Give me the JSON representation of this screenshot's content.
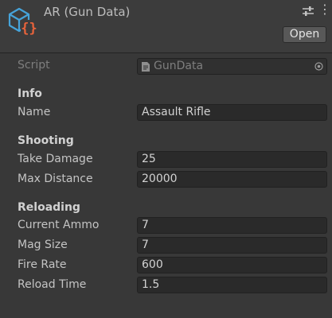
{
  "header": {
    "title": "AR (Gun Data)",
    "icon": "scriptable-object-icon",
    "open_label": "Open"
  },
  "script": {
    "label": "Script",
    "value": "GunData"
  },
  "sections": {
    "info": {
      "heading": "Info",
      "name_label": "Name",
      "name_value": "Assault Rifle"
    },
    "shooting": {
      "heading": "Shooting",
      "take_damage_label": "Take Damage",
      "take_damage_value": "25",
      "max_distance_label": "Max Distance",
      "max_distance_value": "20000"
    },
    "reloading": {
      "heading": "Reloading",
      "current_ammo_label": "Current Ammo",
      "current_ammo_value": "7",
      "mag_size_label": "Mag Size",
      "mag_size_value": "7",
      "fire_rate_label": "Fire Rate",
      "fire_rate_value": "600",
      "reload_time_label": "Reload Time",
      "reload_time_value": "1.5"
    }
  },
  "colors": {
    "background": "#383838",
    "field_bg": "#2a2a2a",
    "icon_cube": "#46a3d9",
    "icon_braces": "#e8633b"
  }
}
